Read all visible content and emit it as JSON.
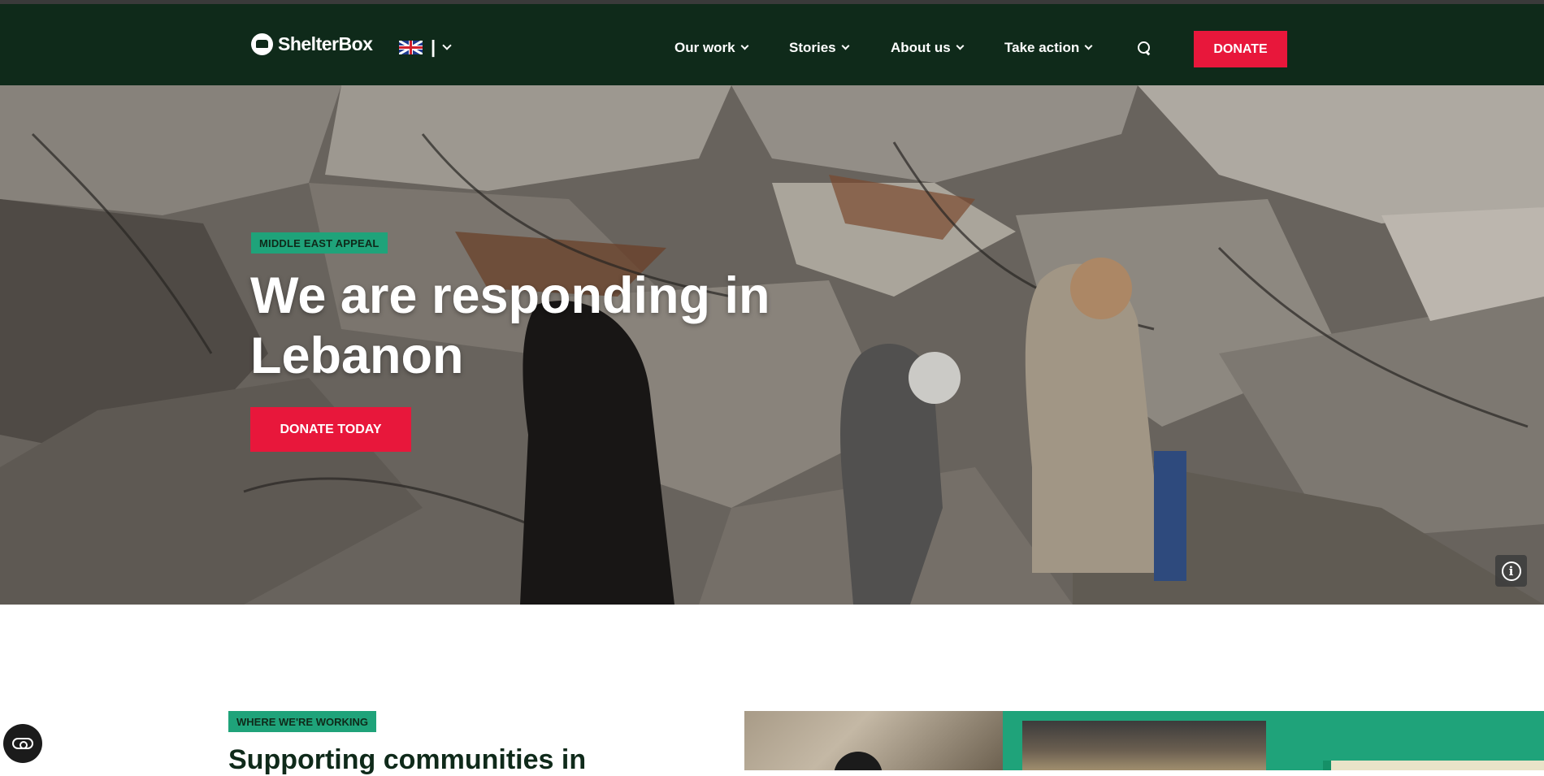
{
  "header": {
    "logo_text": "ShelterBox",
    "language_separator": "|",
    "nav": [
      {
        "label": "Our work"
      },
      {
        "label": "Stories"
      },
      {
        "label": "About us"
      },
      {
        "label": "Take action"
      }
    ],
    "donate_label": "DONATE"
  },
  "hero": {
    "tag": "MIDDLE EAST APPEAL",
    "title": "We are responding in Lebanon",
    "cta_label": "DONATE TODAY"
  },
  "section": {
    "tag": "WHERE WE'RE WORKING",
    "heading": "Supporting communities in"
  },
  "colors": {
    "header_bg": "#0f2a1a",
    "accent_red": "#e8173b",
    "accent_green": "#1fa37a"
  },
  "icons": {
    "logo": "shelterbox-logo-icon",
    "language_flag": "uk-flag-icon",
    "search": "search-icon",
    "info": "info-icon",
    "accessibility": "accessibility-icon"
  }
}
